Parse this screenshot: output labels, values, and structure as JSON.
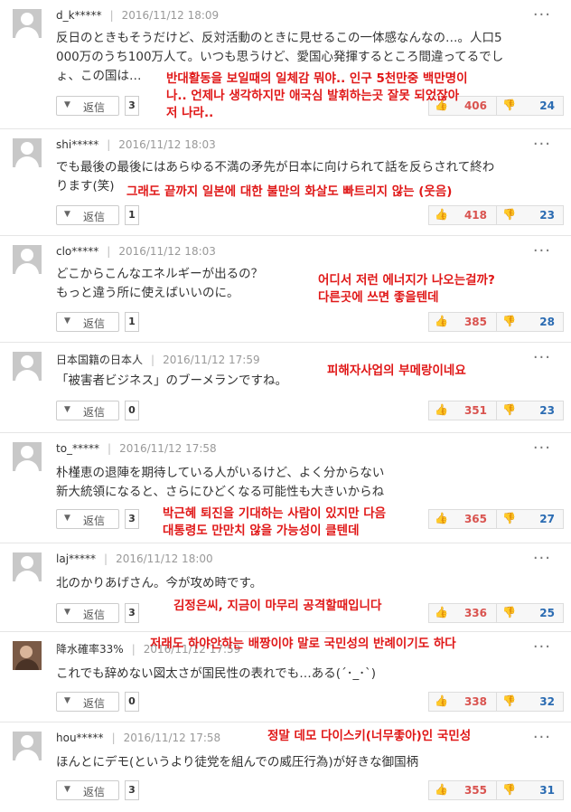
{
  "more_label": "···",
  "comments": [
    {
      "user": "d_k*****",
      "date": "2016/11/12 18:09",
      "text": [
        "反日のときもそうだけど、反対活動のときに見せるこの一体感なんなの…。人口5",
        "000万のうち100万人て。いつも思うけど、愛国心発揮するところ間違ってるでし",
        "ょ、この国は…"
      ],
      "reply_label": "返信",
      "reply_count": "3",
      "up": "406",
      "down": "24",
      "translation": [
        "반대활동을 보일때의 일체감 뭐야.. 인구 5천만중 백만명이",
        "나.. 언제나 생각하지만 애국심 발휘하는곳 잘못 되었잖아",
        "저 나라.."
      ]
    },
    {
      "user": "shi*****",
      "date": "2016/11/12 18:03",
      "text": [
        "でも最後の最後にはあらゆる不満の矛先が日本に向けられて話を反らされて終わ",
        "ります(笑)"
      ],
      "reply_label": "返信",
      "reply_count": "1",
      "up": "418",
      "down": "23",
      "translation": [
        "그래도 끝까지 일본에 대한 불만의 화살도 빠트리지 않는 (웃음)"
      ]
    },
    {
      "user": "clo*****",
      "date": "2016/11/12 18:03",
      "text": [
        "どこからこんなエネルギーが出るの？",
        "もっと違う所に使えばいいのに。"
      ],
      "reply_label": "返信",
      "reply_count": "1",
      "up": "385",
      "down": "28",
      "translation": [
        "어디서 저런 에너지가 나오는걸까?",
        "다른곳에 쓰면 좋을텐데"
      ]
    },
    {
      "user": "日本国籍の日本人",
      "date": "2016/11/12 17:59",
      "text": [
        "「被害者ビジネス」のブーメランですね。"
      ],
      "reply_label": "返信",
      "reply_count": "0",
      "up": "351",
      "down": "23",
      "translation": [
        "피해자사업의 부메랑이네요"
      ]
    },
    {
      "user": "to_*****",
      "date": "2016/11/12 17:58",
      "text": [
        "朴槿恵の退陣を期待している人がいるけど、よく分からない",
        "新大統領になると、さらにひどくなる可能性も大きいからね"
      ],
      "reply_label": "返信",
      "reply_count": "3",
      "up": "365",
      "down": "27",
      "translation": [
        "박근혜 퇴진을 기대하는 사람이 있지만 다음",
        "대통령도  만만치 않을 가능성이 클텐데"
      ]
    },
    {
      "user": "laj*****",
      "date": "2016/11/12 18:00",
      "text": [
        "北のかりあげさん。今が攻め時です。"
      ],
      "reply_label": "返信",
      "reply_count": "3",
      "up": "336",
      "down": "25",
      "translation": [
        "김정은씨, 지금이 마무리 공격할때입니다"
      ]
    },
    {
      "user": "降水確率33%",
      "date": "2016/11/12 17:59",
      "text": [
        "これでも辞めない図太さが国民性の表れでも…ある(´･_･`)"
      ],
      "reply_label": "返信",
      "reply_count": "0",
      "up": "338",
      "down": "32",
      "translation": [
        "저래도 하야안하는 배짱이야 말로 국민성의 반례이기도 하다"
      ]
    },
    {
      "user": "hou*****",
      "date": "2016/11/12 17:58",
      "text": [
        "ほんとにデモ(というより徒党を組んでの威圧行為)が好きな御国柄"
      ],
      "reply_label": "返信",
      "reply_count": "3",
      "up": "355",
      "down": "31",
      "translation": [
        "정말 데모 다이스키(너무좋아)인 국민성"
      ]
    }
  ]
}
